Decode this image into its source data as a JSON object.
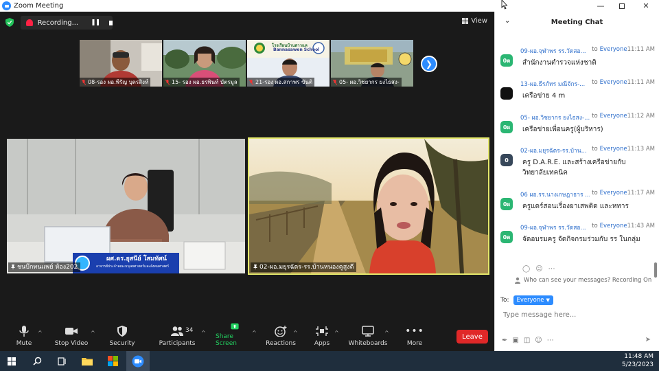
{
  "window": {
    "title": "Zoom Meeting"
  },
  "recording": {
    "label": "Recording..."
  },
  "view": {
    "label": "View"
  },
  "thumbnails": [
    {
      "name": "08-รอง ผอ.พีรัญ บุตรสิงห์"
    },
    {
      "name": "15- รอง ผอ.ธรพินท์ บัตรมูล"
    },
    {
      "name": "21-รอง ผอ.สกาพร ขันติ"
    },
    {
      "name": "05- ผอ.วิชยากร ยงไธสง-"
    }
  ],
  "thumb_school": {
    "line1": "โรงเรียนบ้านสาวแห",
    "line2": "Bannasawen School"
  },
  "videos": {
    "left": {
      "name": "ชนบึกทนแพย์ ห้อง202",
      "caption": "ผศ.ดร.ยุสนีย์ โสมทัศน์",
      "caption_sub": "อาจารย์ประจำคณะมนุษยศาสตร์และสังคมศาสตร์"
    },
    "right": {
      "name": "02-ผอ.มยุรฉัตร-รร.บ้านหนองคูสูงดี"
    }
  },
  "toolbar": {
    "mute": "Mute",
    "stop_video": "Stop Video",
    "security": "Security",
    "participants": "Participants",
    "participants_count": "34",
    "share_screen": "Share Screen",
    "reactions": "Reactions",
    "apps": "Apps",
    "whiteboards": "Whiteboards",
    "more": "More",
    "leave": "Leave"
  },
  "chat": {
    "title": "Meeting Chat",
    "messages": [
      {
        "avatar": "0ต",
        "avatar_color": "#2bb673",
        "sender": "09-ผอ.จุฬาพร รร.วัดสอ...",
        "to": "to",
        "recipient": "Everyone",
        "time": "11:11 AM",
        "text": "สำนักงานตำรวจแห่งชาติ"
      },
      {
        "avatar": "",
        "avatar_color": "#111111",
        "sender": "13-ผอ.ธีรภัทร มณีจักร-...",
        "to": "to",
        "recipient": "Everyone",
        "time": "11:11 AM",
        "text": "เครือข่าย 4 m"
      },
      {
        "avatar": "0ผ",
        "avatar_color": "#2bb673",
        "sender": "05- ผอ.วิชยากร ยงไธสง-...",
        "to": "to",
        "recipient": "Everyone",
        "time": "11:12 AM",
        "text": "เครือข่ายเพื่อนครู(ผู้บริหาร)"
      },
      {
        "avatar": "0",
        "avatar_color": "#37475a",
        "sender": "02-ผอ.มยุรฉัตร-รร.บ้าน...",
        "to": "to",
        "recipient": "Everyone",
        "time": "11:13 AM",
        "text": "ครู D.A.R.E. และสร้างเครือข่ายกับวิทยาลัยเทคนิค"
      },
      {
        "avatar": "0ผ",
        "avatar_color": "#2bb673",
        "sender": "06 ผอ.รร.นางเกษฎาธาร ...",
        "to": "to",
        "recipient": "Everyone",
        "time": "11:17 AM",
        "text": "ครูแดร์สอนเรื่องยาเสพติด และหทาร"
      },
      {
        "avatar": "0ต",
        "avatar_color": "#2bb673",
        "sender": "09-ผอ.จุฬาพร รร.วัดสอ...",
        "to": "to",
        "recipient": "Everyone",
        "time": "11:43 AM",
        "text": "จัดอบรมครู จัดกิจกรมร่วมกับ รร ในกลุ่ม"
      }
    ],
    "who_can_see": "Who can see your messages? Recording On",
    "to_label": "To:",
    "to_value": "Everyone",
    "input_placeholder": "Type message here..."
  },
  "taskbar": {
    "time": "11:48 AM",
    "date": "5/23/2023"
  },
  "colors": {
    "accent": "#2d8cff",
    "leave": "#e02828",
    "share": "#23d160",
    "active_speaker": "#e5e96b"
  }
}
